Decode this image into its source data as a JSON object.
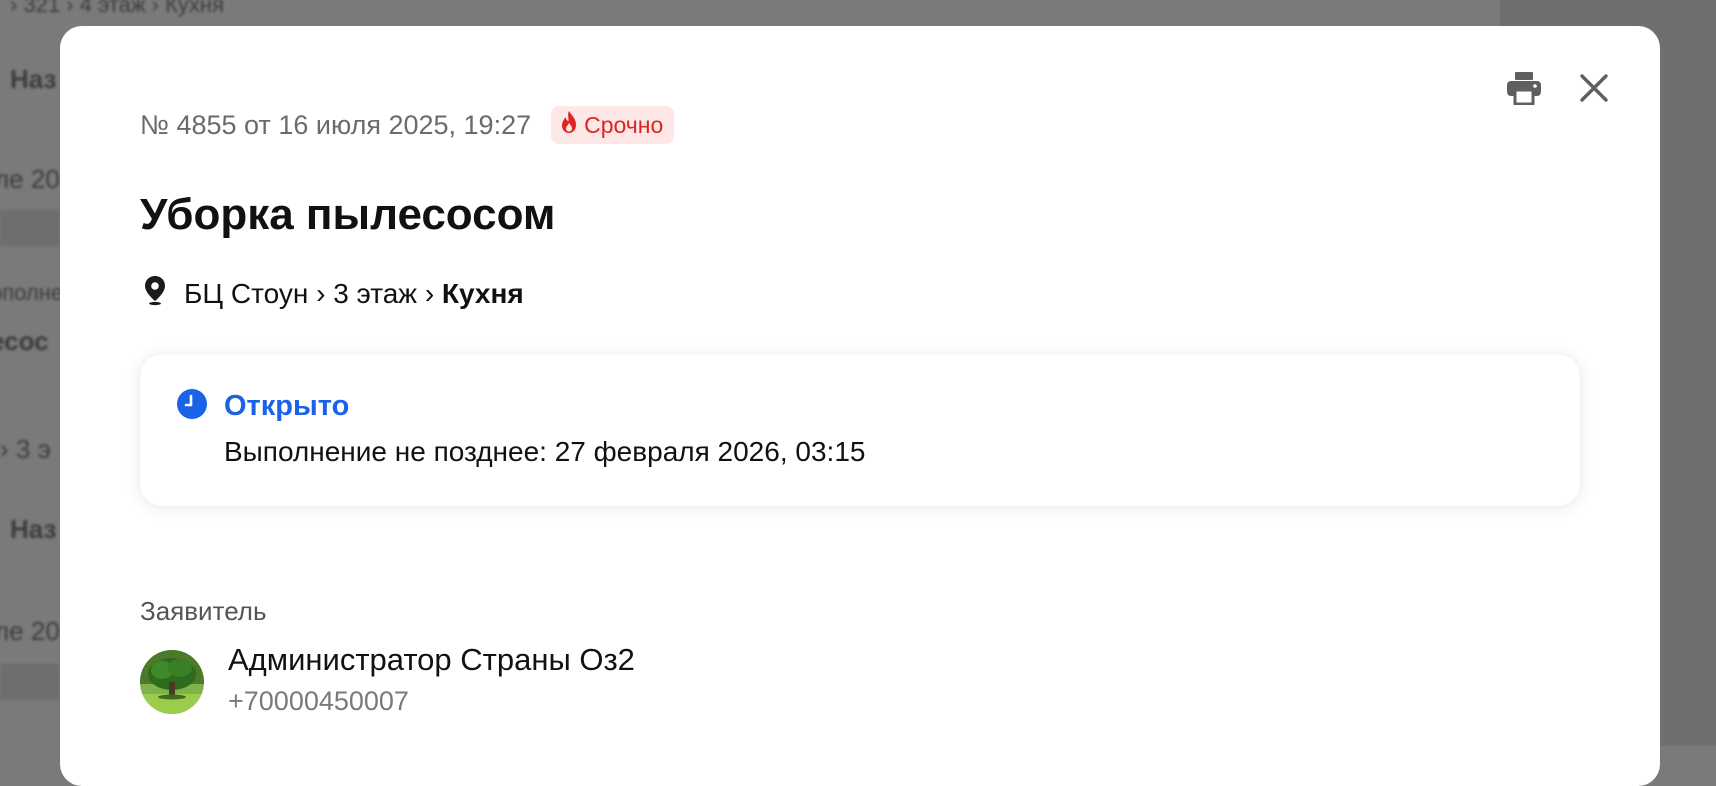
{
  "background": {
    "fragments": [
      "› 321 › 4 этаж › Кухня",
      "Наз",
      "ле 20",
      "рполне",
      "есос",
      "› 3 э",
      "Наз",
      "ле 20"
    ]
  },
  "modal": {
    "meta": "№ 4855 от 16 июля 2025, 19:27",
    "urgent_label": "Срочно",
    "title": "Уборка пылесосом",
    "location": {
      "path": "БЦ Стоун › 3 этаж › ",
      "room": "Кухня"
    },
    "status": {
      "label": "Открыто",
      "deadline": "Выполнение не позднее: 27 февраля 2026, 03:15"
    },
    "applicant": {
      "section_label": "Заявитель",
      "name": "Администратор Страны Оз2",
      "phone": "+70000450007"
    },
    "icons": [
      "print-icon",
      "close-icon",
      "fire-icon",
      "location-pin-icon",
      "clock-icon",
      "tree-avatar"
    ]
  },
  "colors": {
    "accent": "#1a63e8",
    "urgent": "#e02424",
    "urgent_bg": "#fde7e7",
    "overlay": "#7a7a7a"
  }
}
